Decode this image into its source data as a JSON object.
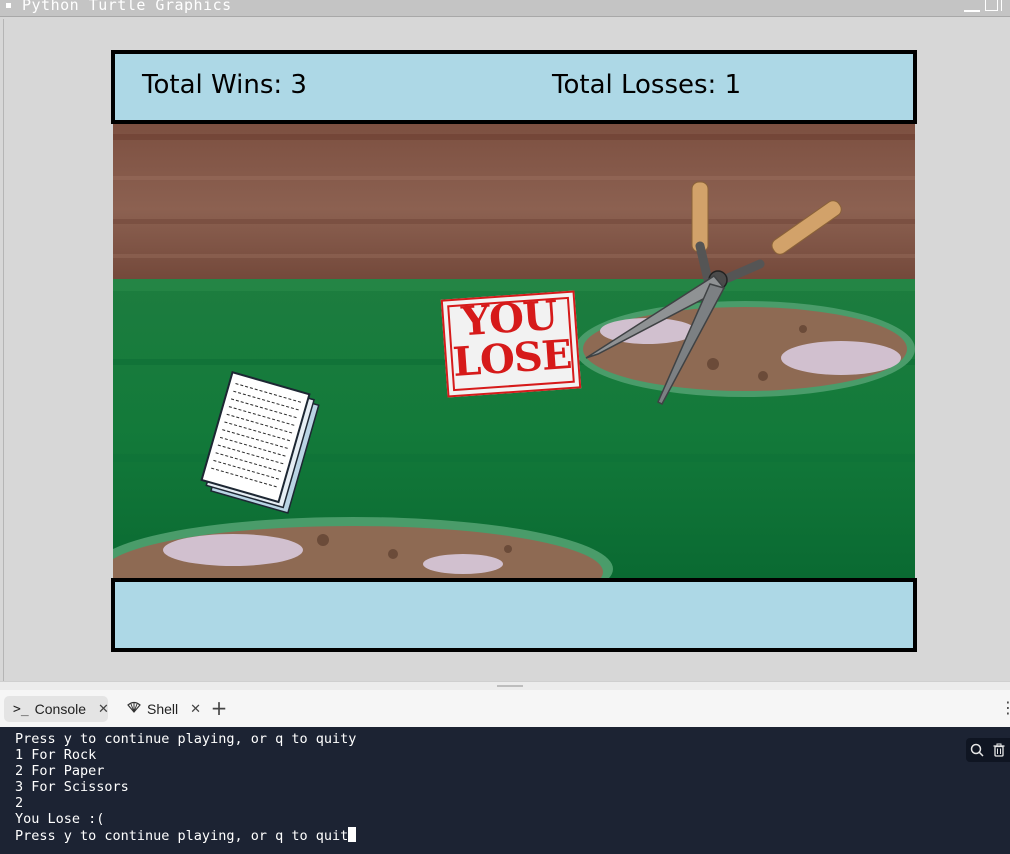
{
  "window": {
    "title": "Python Turtle Graphics"
  },
  "scoreboard": {
    "wins_label": "Total Wins: 3",
    "losses_label": "Total Losses: 1"
  },
  "game": {
    "result_badge_line1": "YOU",
    "result_badge_line2": "LOSE",
    "player_choice": "paper-icon",
    "computer_choice": "scissors-icon"
  },
  "tabs": [
    {
      "label": "Console",
      "icon": "terminal-icon",
      "active": true
    },
    {
      "label": "Shell",
      "icon": "shell-icon",
      "active": false
    }
  ],
  "console": {
    "lines": [
      "Press y to continue playing, or q to quity",
      "1 For Rock",
      "2 For Paper",
      "3 For Scissors",
      "2",
      "You Lose :(",
      "Press y to continue playing, or q to quit"
    ]
  },
  "colors": {
    "panel": "#add8e6",
    "console_bg": "#1c2333",
    "badge_red": "#d61a1a"
  }
}
